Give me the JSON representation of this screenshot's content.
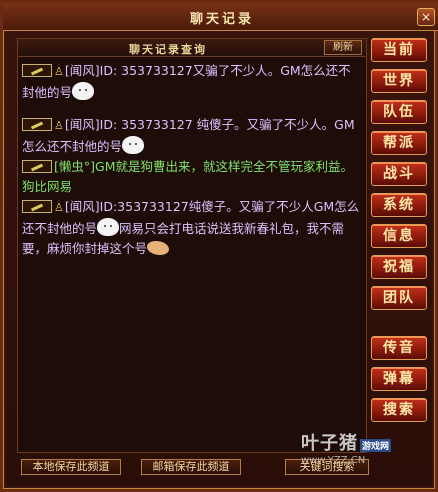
{
  "window": {
    "title": "聊天记录",
    "close_label": "×"
  },
  "chat_panel": {
    "header_title": "聊天记录查询",
    "refresh_label": "刷新"
  },
  "messages": [
    {
      "sender": "[闻风]",
      "text_before": "ID: 353733127又骗了不少人。GM怎么还不封他的号",
      "text_after": "",
      "sender_color": "#d9c2ff",
      "text_color": "#d9c2ff"
    },
    {
      "sender": "[闻风]",
      "text_before": "ID: 353733127 纯傻子。又骗了不少人。GM怎么还不封他的号",
      "text_after": "",
      "sender_color": "#d9c2ff",
      "text_color": "#d9c2ff"
    },
    {
      "sender": "[懒虫°]",
      "text_before": "GM就是狗曹出来，就这样完全不管玩家利益。狗比网易",
      "text_after": "",
      "sender_color": "#7fe06a",
      "text_color": "#7fe06a"
    },
    {
      "sender": "[闻风]",
      "text_before": "ID:353733127纯傻子。又骗了不少人GM怎么还不封他的号",
      "text_after": "网易只会打电话说送我新春礼包，我不需要，麻烦你封掉这个号",
      "sender_color": "#d9c2ff",
      "text_color": "#d9c2ff"
    }
  ],
  "side_nav": [
    "当前",
    "世界",
    "队伍",
    "帮派",
    "战斗",
    "系统",
    "信息",
    "祝福",
    "团队"
  ],
  "side_nav_2": [
    "传音",
    "弹幕",
    "搜索"
  ],
  "bottom_bar": {
    "local_save": "本地保存此频道",
    "mail_save": "邮箱保存此频道",
    "keyword_search": "关键词搜索"
  },
  "watermark": {
    "main": "叶子猪",
    "sub": "游戏网",
    "url": "www.YZZ.CN"
  },
  "colors": {
    "accent": "#c0301a",
    "gold": "#e0a050",
    "bg": "#1e0c08"
  }
}
